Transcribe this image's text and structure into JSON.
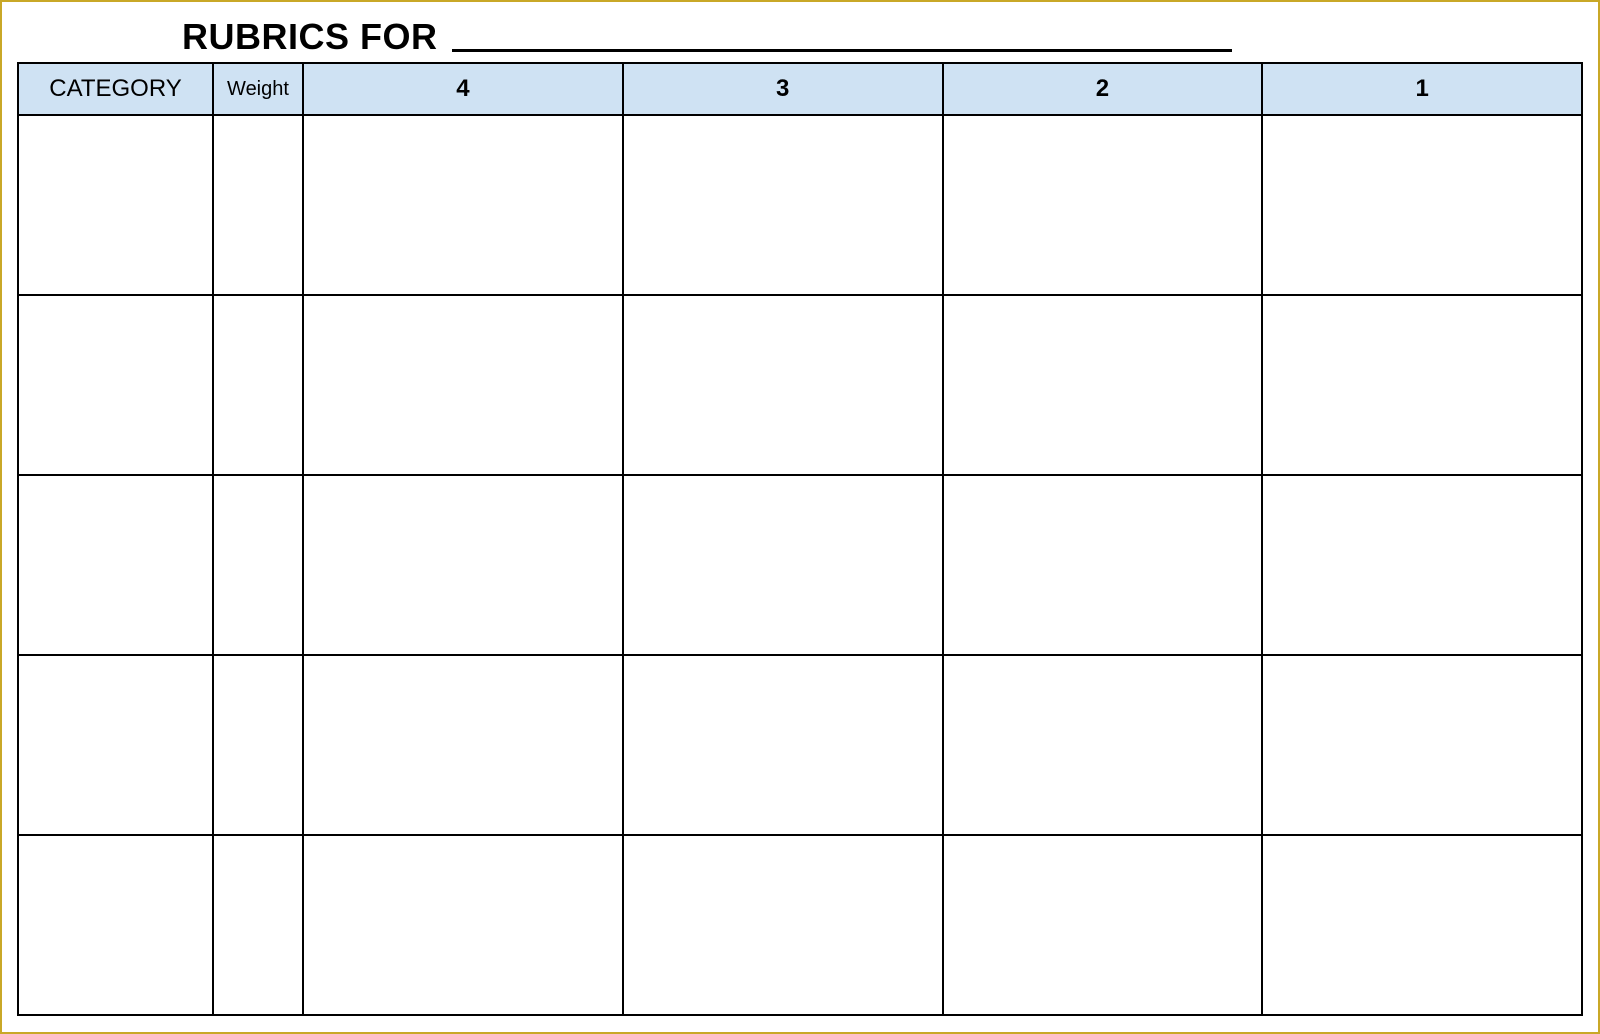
{
  "title": "RUBRICS FOR",
  "headers": {
    "category": "CATEGORY",
    "weight": "Weight",
    "score4": "4",
    "score3": "3",
    "score2": "2",
    "score1": "1"
  },
  "rows": [
    {
      "category": "",
      "weight": "",
      "s4": "",
      "s3": "",
      "s2": "",
      "s1": ""
    },
    {
      "category": "",
      "weight": "",
      "s4": "",
      "s3": "",
      "s2": "",
      "s1": ""
    },
    {
      "category": "",
      "weight": "",
      "s4": "",
      "s3": "",
      "s2": "",
      "s1": ""
    },
    {
      "category": "",
      "weight": "",
      "s4": "",
      "s3": "",
      "s2": "",
      "s1": ""
    },
    {
      "category": "",
      "weight": "",
      "s4": "",
      "s3": "",
      "s2": "",
      "s1": ""
    }
  ],
  "colors": {
    "frame_border": "#c9a827",
    "header_fill": "#cfe2f3",
    "cell_border": "#000000"
  }
}
